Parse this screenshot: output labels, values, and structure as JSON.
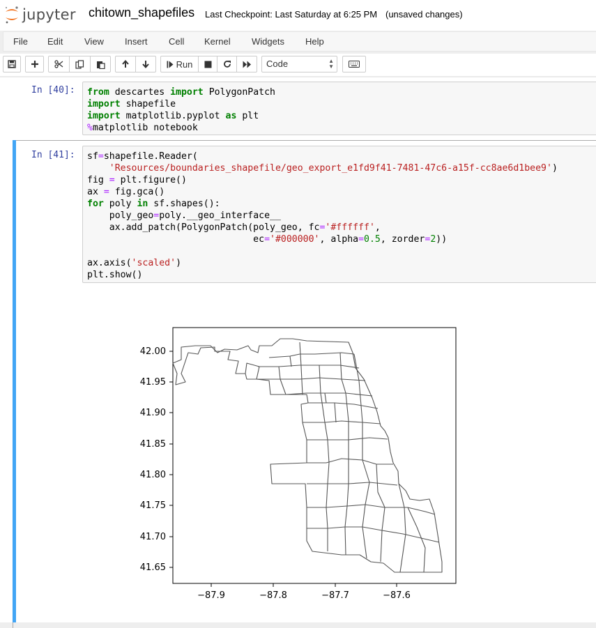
{
  "header": {
    "logo_text": "jupyter",
    "notebook_name": "chitown_shapefiles",
    "checkpoint": "Last Checkpoint: Last Saturday at 6:25 PM",
    "status": "(unsaved changes)"
  },
  "menu": [
    "File",
    "Edit",
    "View",
    "Insert",
    "Cell",
    "Kernel",
    "Widgets",
    "Help"
  ],
  "toolbar": {
    "run_label": "Run",
    "cell_type": "Code",
    "icons": [
      "save-icon",
      "add-icon",
      "cut-icon",
      "copy-icon",
      "paste-icon",
      "move-up-icon",
      "move-down-icon",
      "run-icon",
      "stop-icon",
      "restart-icon",
      "fast-forward-icon",
      "keyboard-icon"
    ]
  },
  "cells": [
    {
      "prompt": "In [40]:",
      "lines": [
        "from descartes import PolygonPatch",
        "import shapefile",
        "import matplotlib.pyplot as plt",
        "%matplotlib notebook"
      ]
    },
    {
      "prompt": "In [41]:",
      "lines": [
        "sf=shapefile.Reader(",
        "    'Resources/boundaries_shapefile/geo_export_e1fd9f41-7481-47c6-a15f-cc8ae6d1bee9')",
        "fig = plt.figure()",
        "ax = fig.gca()",
        "for poly in sf.shapes():",
        "    poly_geo=poly.__geo_interface__",
        "    ax.add_patch(PolygonPatch(poly_geo, fc='#ffffff',",
        "                              ec='#000000', alpha=0.5, zorder=2))",
        "",
        "ax.axis('scaled')",
        "plt.show()"
      ]
    }
  ],
  "chart_data": {
    "type": "map",
    "xlim": [
      -87.95,
      -87.5
    ],
    "ylim": [
      41.63,
      42.04
    ],
    "x_ticks": [
      -87.9,
      -87.8,
      -87.7,
      -87.6
    ],
    "x_tick_labels": [
      "−87.9",
      "−87.8",
      "−87.7",
      "−87.6"
    ],
    "y_ticks": [
      42.0,
      41.95,
      41.9,
      41.85,
      41.8,
      41.75,
      41.7,
      41.65
    ],
    "y_tick_labels": [
      "42.00",
      "41.95",
      "41.90",
      "41.85",
      "41.80",
      "41.75",
      "41.70",
      "41.65"
    ],
    "fill_color": "#ffffff",
    "edge_color": "#000000",
    "alpha": 0.5
  }
}
